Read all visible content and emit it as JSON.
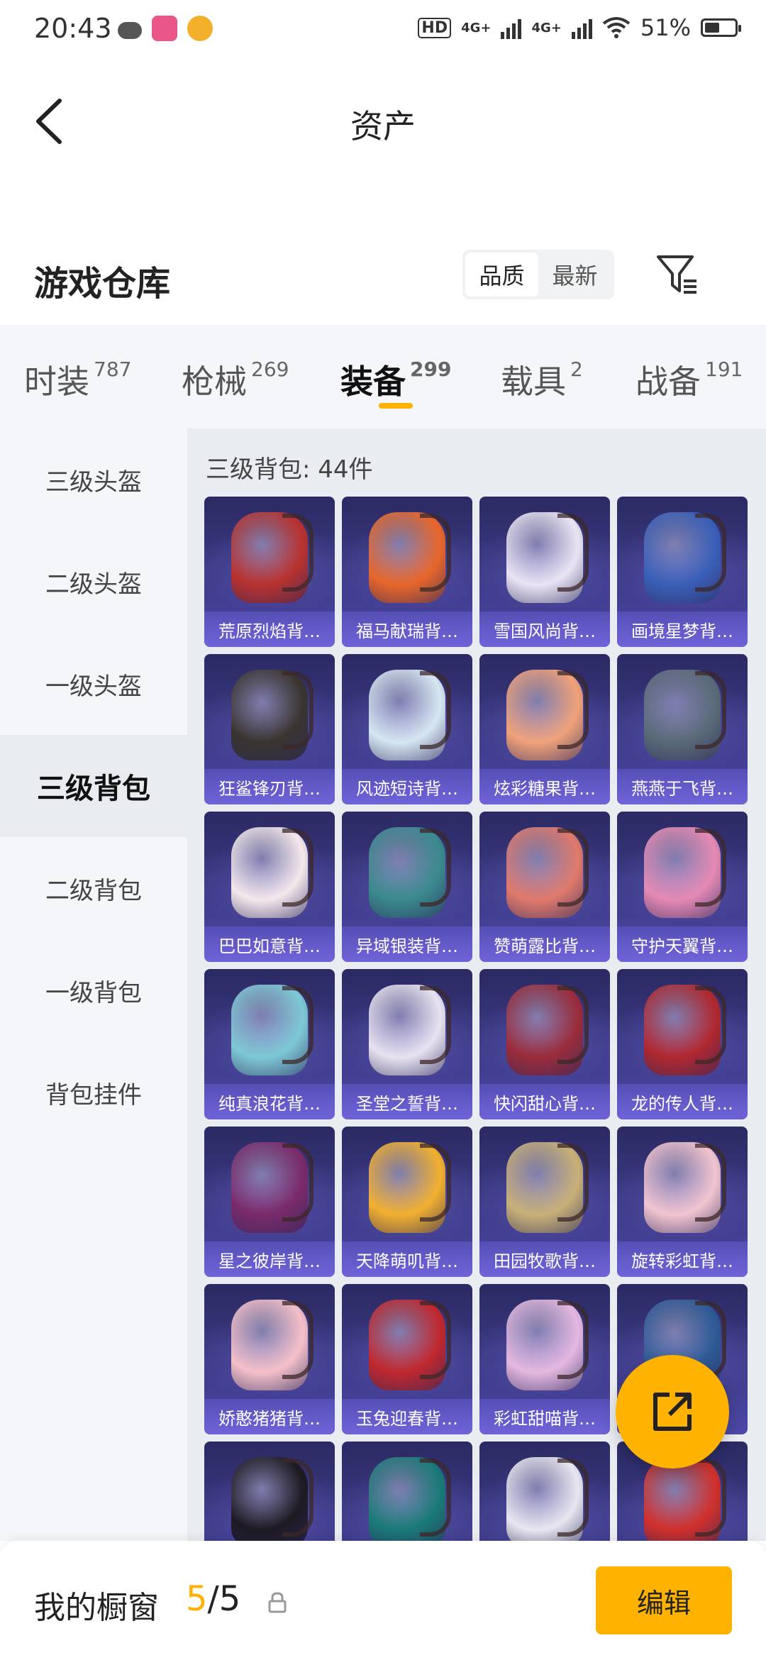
{
  "status_bar": {
    "time": "20:43",
    "network_labels": [
      "HD",
      "4G+",
      "4G+"
    ],
    "battery": "51%",
    "battery_level": 0.51
  },
  "nav": {
    "back_icon": "chevron-left-icon",
    "title": "资产"
  },
  "section": {
    "title": "游戏仓库",
    "sort_options": [
      "品质",
      "最新"
    ],
    "sort_selected": "品质",
    "filter_icon": "filter-icon"
  },
  "tabs": [
    {
      "label": "时装",
      "count": "787"
    },
    {
      "label": "枪械",
      "count": "269"
    },
    {
      "label": "装备",
      "count": "299",
      "active": true
    },
    {
      "label": "载具",
      "count": "2"
    },
    {
      "label": "战备",
      "count": "191"
    }
  ],
  "sidebar": {
    "items": [
      "三级头盔",
      "二级头盔",
      "一级头盔",
      "三级背包",
      "二级背包",
      "一级背包",
      "背包挂件"
    ],
    "active_index": 3
  },
  "grid": {
    "title": "三级背包: 44件",
    "items": [
      {
        "label": "荒原烈焰背…",
        "color": "#b8322e"
      },
      {
        "label": "福马献瑞背…",
        "color": "#e8662a"
      },
      {
        "label": "雪国风尚背…",
        "color": "#e9e4f4"
      },
      {
        "label": "画境星梦背…",
        "color": "#3a5fb8"
      },
      {
        "label": "狂鲨锋刃背…",
        "color": "#3a3430"
      },
      {
        "label": "风迹短诗背…",
        "color": "#d6e6f2"
      },
      {
        "label": "炫彩糖果背…",
        "color": "#f0a27a"
      },
      {
        "label": "燕燕于飞背…",
        "color": "#5a6a78"
      },
      {
        "label": "巴巴如意背…",
        "color": "#f4e8ec"
      },
      {
        "label": "异域银装背…",
        "color": "#3a8a8e"
      },
      {
        "label": "赞萌露比背…",
        "color": "#e07a6c"
      },
      {
        "label": "守护天翼背…",
        "color": "#e58ab4"
      },
      {
        "label": "纯真浪花背…",
        "color": "#7ec8d6"
      },
      {
        "label": "圣堂之誓背…",
        "color": "#e8e2f0"
      },
      {
        "label": "快闪甜心背…",
        "color": "#9a2c3c"
      },
      {
        "label": "龙的传人背…",
        "color": "#b02830"
      },
      {
        "label": "星之彼岸背…",
        "color": "#7a2a6a"
      },
      {
        "label": "天降萌叽背…",
        "color": "#f2b030"
      },
      {
        "label": "田园牧歌背…",
        "color": "#c8b078"
      },
      {
        "label": "旋转彩虹背…",
        "color": "#f2c4d0"
      },
      {
        "label": "娇憨猪猪背…",
        "color": "#f4c0c8"
      },
      {
        "label": "玉兔迎春背…",
        "color": "#c0282e"
      },
      {
        "label": "彩虹甜喵背…",
        "color": "#e4b8e0"
      },
      {
        "label": "",
        "color": "#2e5a96"
      },
      {
        "label": "",
        "color": "#1e1a22"
      },
      {
        "label": "",
        "color": "#1a7a78"
      },
      {
        "label": "",
        "color": "#e8e6f0"
      },
      {
        "label": "",
        "color": "#d0302c"
      }
    ]
  },
  "fab": {
    "icon": "share-external-icon"
  },
  "bottom_bar": {
    "title": "我的橱窗",
    "count_current": "5",
    "count_sep": "/",
    "count_total": "5",
    "lock_icon": "lock-icon",
    "edit_label": "编辑"
  }
}
